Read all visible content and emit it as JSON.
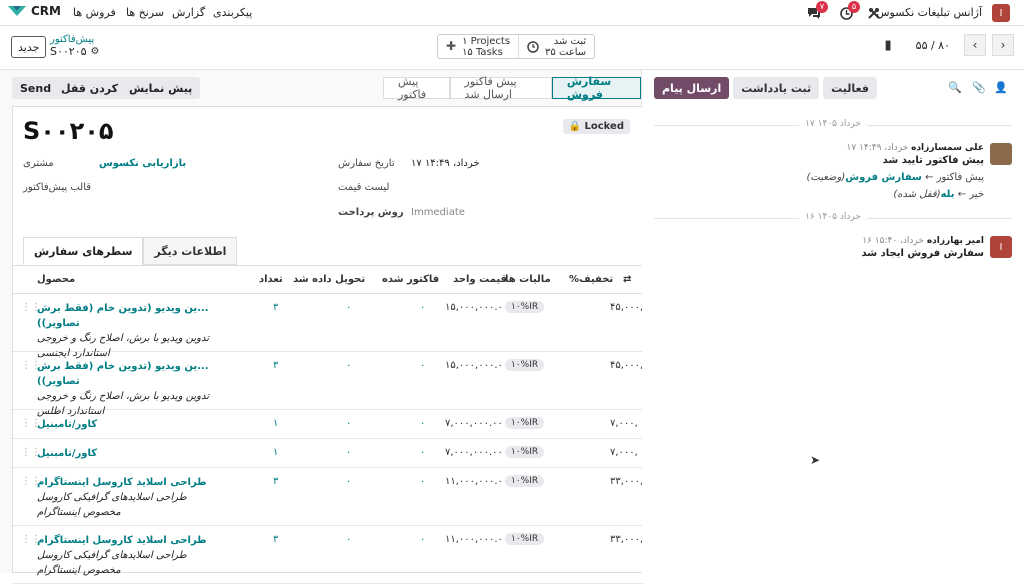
{
  "topbar": {
    "app_name": "CRM",
    "menus": [
      "پیکربندی",
      "گزارش",
      "سرنخ ها",
      "فروش ها"
    ],
    "company": "آژانس تبلیغات نکسوس",
    "avatar_letter": "I",
    "chat_badge": "۷",
    "activity_badge": "۵"
  },
  "control": {
    "new_label": "جدید",
    "breadcrumb_parent": "پیش‌فاکتور",
    "breadcrumb_current": "S۰۰۲۰۵",
    "projects_label": "۱ Projects",
    "tasks_label": "۱۵ Tasks",
    "registered_label": "ثبت شد",
    "registered_time": "ساعت ۳۵",
    "pager_value": "۵۵ / ۸۰"
  },
  "buttons": {
    "send": "Send",
    "unlock": "باز کردن قفل",
    "preview": "پیش نمایش"
  },
  "stages": [
    "سفارش فروش",
    "پیش فاکتور ارسال شد",
    "پیش فاکتور"
  ],
  "form": {
    "locked": "Locked",
    "order_name": "S۰۰۲۰۵",
    "customer_label": "مشتری",
    "customer_value": "بازاریابی نکسوس",
    "template_label": "قالب پیش‌فاکتور",
    "order_date_label": "تاریخ سفارش",
    "order_date_value": "خرداد، ۱۴:۴۹ ۱۷",
    "pricelist_label": "لیست قیمت",
    "payment_label": "روش پرداخت",
    "payment_value": "Immediate"
  },
  "tabs": [
    "سطرهای سفارش",
    "اطلاعات دیگر"
  ],
  "table": {
    "headers": {
      "product": "محصول",
      "qty": "تعداد",
      "delivered": "تحویل داده شد",
      "invoiced": "فاکتور شده",
      "unit_price": "قیمت واحد",
      "taxes": "مالیات ها",
      "discount": "%تخفیف"
    },
    "rows": [
      {
        "product": "...ین ویدیو (تدوین خام (فقط برش تصاویر))",
        "desc1": "تدوین ویدیو با برش، اصلاح رنگ و خروجی",
        "desc2": "استاندارد ایجنسی",
        "qty": "۳",
        "delivered": "۰",
        "invoiced": "۰",
        "price": "۱۵,۰۰۰,۰۰۰.۰۰",
        "tax": "۱۰%IR",
        "subtotal": "۴۵,۰۰۰,"
      },
      {
        "product": "...ین ویدیو (تدوین خام (فقط برش تصاویر))",
        "desc1": "تدوین ویدیو با برش، اصلاح رنگ و خروجی",
        "desc2": "استاندارد اطلس",
        "qty": "۳",
        "delivered": "۰",
        "invoiced": "۰",
        "price": "۱۵,۰۰۰,۰۰۰.۰۰",
        "tax": "۱۰%IR",
        "subtotal": "۴۵,۰۰۰,"
      },
      {
        "product": "کاور/تامبنیل",
        "desc1": "",
        "desc2": "",
        "qty": "۱",
        "delivered": "۰",
        "invoiced": "۰",
        "price": "۷,۰۰۰,۰۰۰.۰۰",
        "tax": "۱۰%IR",
        "subtotal": "۷,۰۰۰,"
      },
      {
        "product": "کاور/تامبنیل",
        "desc1": "",
        "desc2": "",
        "qty": "۱",
        "delivered": "۰",
        "invoiced": "۰",
        "price": "۷,۰۰۰,۰۰۰.۰۰",
        "tax": "۱۰%IR",
        "subtotal": "۷,۰۰۰,"
      },
      {
        "product": "طراحی اسلاید کاروسل اینستاگرام",
        "desc1": "طراحی اسلایدهای گرافیکی کاروسل",
        "desc2": "مخصوص اینستاگرام",
        "qty": "۳",
        "delivered": "۰",
        "invoiced": "۰",
        "price": "۱۱,۰۰۰,۰۰۰.۰۰",
        "tax": "۱۰%IR",
        "subtotal": "۳۳,۰۰۰,"
      },
      {
        "product": "طراحی اسلاید کاروسل اینستاگرام",
        "desc1": "طراحی اسلایدهای گرافیکی کاروسل",
        "desc2": "مخصوص اینستاگرام",
        "qty": "۳",
        "delivered": "۰",
        "invoiced": "۰",
        "price": "۱۱,۰۰۰,۰۰۰.۰۰",
        "tax": "۱۰%IR",
        "subtotal": "۳۳,۰۰۰,"
      }
    ]
  },
  "chatter": {
    "activity": "فعالیت",
    "log_note": "ثبت یادداشت",
    "send_message": "ارسال پیام",
    "date1": "خرداد ۱۴۰۵ ۱۷",
    "date2": "خرداد ۱۴۰۵ ۱۶",
    "msg1": {
      "author": "علی سمسارزاده",
      "time": "خرداد، ۱۴:۴۹ ۱۷",
      "body": "پیش فاکتور تایید شد",
      "change1_old": "پیش فاکتور",
      "change1_new": "سفارش فروش",
      "change1_field": "(وضعیت)",
      "change2_old": "خیر",
      "change2_new": "بله",
      "change2_field": "(قفل شده)"
    },
    "msg2": {
      "author": "امیر بهارزاده",
      "time": "خرداد، ۱۵:۴۰ ۱۶",
      "body": "سفارش فروش ایجاد شد",
      "avatar_letter": "I"
    }
  }
}
